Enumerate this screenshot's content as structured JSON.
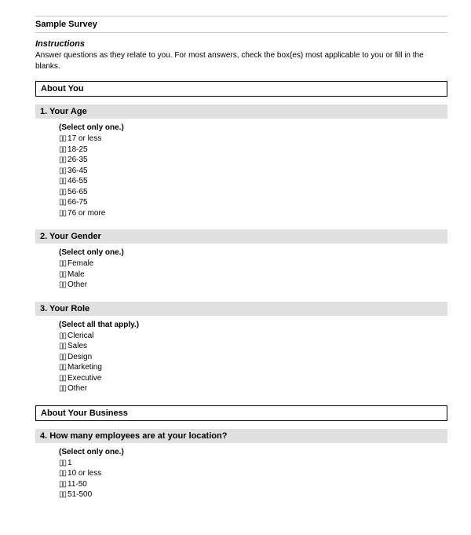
{
  "boxGlyph": "▯▯",
  "title": "Sample Survey",
  "instructions": {
    "heading": "Instructions",
    "text": "Answer questions as they relate to you. For most answers, check the box(es) most applicable to you or fill in the blanks."
  },
  "sections": [
    {
      "header": "About You",
      "questions": [
        {
          "title": "1. Your Age",
          "hint": "(Select only one.)",
          "options": [
            "17 or less",
            "18-25",
            "26-35",
            "36-45",
            "46-55",
            "56-65",
            "66-75",
            "76 or more"
          ]
        },
        {
          "title": "2. Your Gender",
          "hint": "(Select only one.)",
          "options": [
            "Female",
            "Male",
            "Other"
          ]
        },
        {
          "title": "3. Your Role",
          "hint": "(Select all that apply.)",
          "options": [
            "Clerical",
            "Sales",
            "Design",
            "Marketing",
            "Executive",
            "Other"
          ]
        }
      ]
    },
    {
      "header": "About Your Business",
      "questions": [
        {
          "title": "4. How many employees are at your location?",
          "hint": "(Select only one.)",
          "options": [
            "1",
            "10 or less",
            "11-50",
            "51-500"
          ]
        }
      ]
    }
  ]
}
